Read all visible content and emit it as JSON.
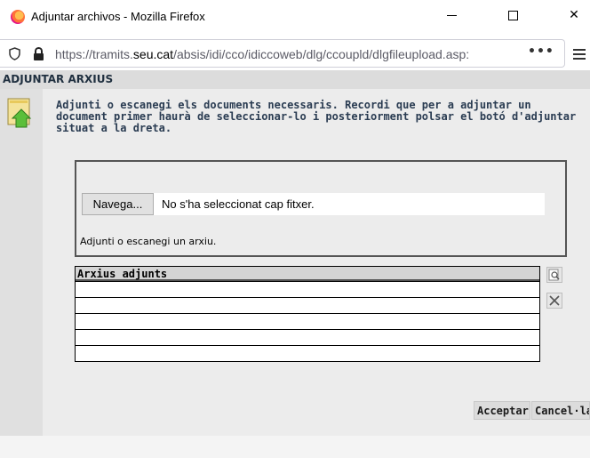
{
  "window": {
    "title": "Adjuntar archivos - Mozilla Firefox",
    "minimize_glyph": "—",
    "close_glyph": "✕"
  },
  "urlbar": {
    "url_prefix": "https://tramits.",
    "url_domain": "seu.cat",
    "url_suffix": "/absis/idi/cco/idiccoweb/dlg/ccoupld/dlgfileupload.asp:",
    "more_glyph": "•••"
  },
  "dialog": {
    "header": "ADJUNTAR ARXIUS",
    "instructions": "Adjunti o escanegi els documents necessaris. Recordi que per a adjuntar un document primer haurà de seleccionar-lo i posteriorment polsar el botó d'adjuntar situat a la dreta.",
    "file_input": {
      "browse_label": "Navega...",
      "status": "No s'ha seleccionat cap fitxer."
    },
    "file_hint": "Adjunti o escanegi un arxiu.",
    "attached": {
      "header": "Arxius adjunts",
      "rows": [
        "",
        "",
        "",
        "",
        ""
      ]
    },
    "accept_label": "Acceptar",
    "cancel_label": "Cancel·lar"
  },
  "icons": {
    "app": "firefox-logo-icon",
    "security": "shield-icon",
    "lock": "lock-icon",
    "upload": "upload-folder-icon",
    "view": "magnifier-icon",
    "delete": "close-x-icon",
    "menu": "hamburger-menu-icon"
  },
  "colors": {
    "header_bg": "#dcdcdc",
    "content_bg": "#ececec",
    "instruction_text": "#2a3c52"
  }
}
